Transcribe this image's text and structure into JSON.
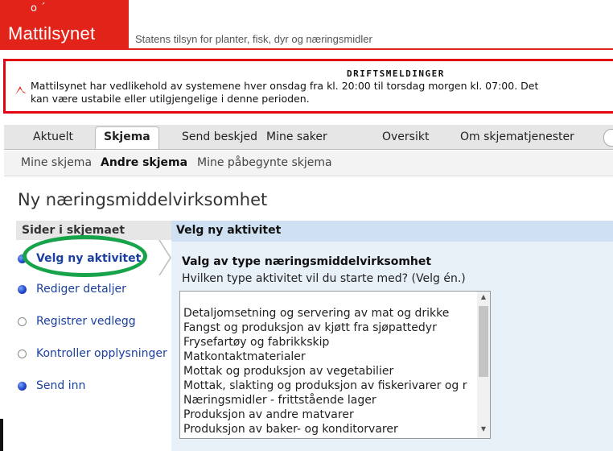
{
  "header": {
    "logo_mark": "o ´",
    "logo_name": "Mattilsynet",
    "tagline": "Statens tilsyn for planter, fisk, dyr og næringsmidler"
  },
  "alert": {
    "title": "DRIFTSMELDINGER",
    "line1": "Mattilsynet har vedlikehold av systemene hver onsdag fra kl. 20:00 til torsdag morgen kl. 07:00. Det",
    "line2": "kan være ustabile eller utilgjengelige i denne perioden."
  },
  "tabs": [
    {
      "label": "Aktuelt"
    },
    {
      "label": "Skjema",
      "active": true
    },
    {
      "label": "Send beskjed"
    },
    {
      "label": "Mine saker"
    },
    {
      "label": "Oversikt"
    },
    {
      "label": "Om skjematjenester"
    }
  ],
  "subnav": [
    {
      "label": "Mine skjema"
    },
    {
      "label": "Andre skjema",
      "active": true
    },
    {
      "label": "Mine påbegynte skjema"
    }
  ],
  "page_title": "Ny næringsmiddelvirksomhet",
  "sidebar": {
    "heading": "Sider i skjemaet",
    "items": [
      {
        "label": "Velg ny aktivitet",
        "state": "current"
      },
      {
        "label": "Rediger detaljer",
        "state": "filled"
      },
      {
        "label": "Registrer vedlegg",
        "state": "empty"
      },
      {
        "label": "Kontroller opplysninger",
        "state": "empty"
      },
      {
        "label": "Send inn",
        "state": "filled"
      }
    ]
  },
  "content": {
    "heading": "Velg ny aktivitet",
    "section_title": "Valg av type næringsmiddelvirksomhet",
    "question": "Hvilken type aktivitet vil du starte med? (Velg én.)",
    "options": [
      "",
      "Detaljomsetning og servering av mat og drikke",
      "Fangst og produksjon av kjøtt fra sjøpattedyr",
      "Frysefartøy og fabrikkskip",
      "Matkontaktmaterialer",
      "Mottak og produksjon av vegetabilier",
      "Mottak, slakting og produksjon av fiskerivarer og r",
      "Næringsmidler - frittstående lager",
      "Produksjon av andre matvarer",
      "Produksjon av baker- og konditorvarer"
    ]
  },
  "colors": {
    "brand_red": "#e2231a",
    "highlight_ring": "#17a34a",
    "link_blue": "#1a3f9e",
    "content_header": "#cfe0f2"
  },
  "icons": [
    "alert-icon",
    "scroll-up-icon",
    "scroll-down-icon"
  ]
}
